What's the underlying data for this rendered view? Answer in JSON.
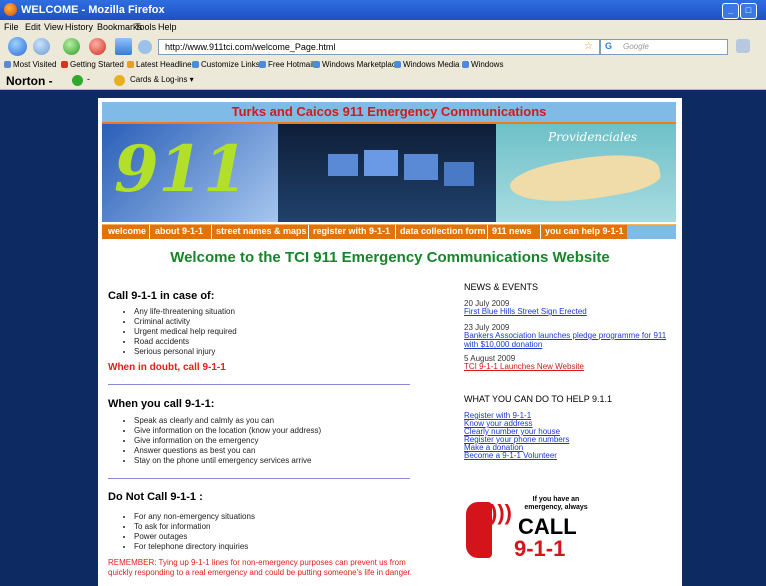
{
  "window": {
    "title": "WELCOME - Mozilla Firefox"
  },
  "menu": [
    "File",
    "Edit",
    "View",
    "History",
    "Bookmarks",
    "Tools",
    "Help"
  ],
  "toolbar": {
    "url": "http://www.911tci.com/welcome_Page.html",
    "search_placeholder": "Google"
  },
  "bookmarks": [
    "Most Visited",
    "Getting Started",
    "Latest Headlines",
    "Customize Links",
    "Free Hotmail",
    "Windows Marketplace",
    "Windows Media",
    "Windows"
  ],
  "norton": {
    "label": "Norton",
    "cards_label": "Cards & Log-ins"
  },
  "site": {
    "header_title": "Turks and Caicos 911 Emergency Communications",
    "banner_911": "911",
    "banner_map_label": "Providenciales",
    "nav": [
      "welcome",
      "about 9-1-1",
      "street names & maps",
      "register with 9-1-1",
      "data collection form",
      "911 news",
      "you can help 9-1-1"
    ],
    "welcome_heading": "Welcome to the TCI 911 Emergency Communications Website"
  },
  "left": {
    "call_heading": "Call 9-1-1 in case of:",
    "call_items": [
      "Any life-threatening situation",
      "Criminal activity",
      "Urgent medical help required",
      "Road accidents",
      "Serious personal injury"
    ],
    "doubt": "When in doubt, call 9-1-1",
    "when_heading": "When you call 9-1-1:",
    "when_items": [
      "Speak as clearly and calmly as you can",
      "Give information on the location (know your address)",
      "Give information on the emergency",
      "Answer questions as best you can",
      "Stay on the phone until emergency services arrive"
    ],
    "donot_heading": "Do Not Call 9-1-1 :",
    "donot_items": [
      "For any non-emergency situations",
      "To ask for information",
      "Power outages",
      "For telephone directory inquiries"
    ],
    "remember": "REMEMBER: Tying up 9-1-1 lines for non-emergency purposes can prevent us from quickly responding to a real emergency and could be putting someone's life in danger."
  },
  "right": {
    "news_heading": "NEWS & EVENTS",
    "news": [
      {
        "date": "20 July 2009",
        "link": "First Blue Hills Street Sign Erected"
      },
      {
        "date": "23 July 2009",
        "link": "Bankers Association launches pledge programme for 911 with $10,000 donation"
      },
      {
        "date": "5 August 2009",
        "link": "TCI 9-1-1 Launches New Website"
      }
    ],
    "help_heading": "WHAT YOU CAN DO TO HELP 9.1.1",
    "help_links": [
      "Register with 9-1-1",
      "Know your address",
      "Clearly number your house",
      "Register your phone numbers",
      "Make a donation",
      "Become a 9-1-1 Volunteer"
    ],
    "call_small": "If you have an emergency, always",
    "call_big": "CALL",
    "call_num": "9-1-1"
  }
}
